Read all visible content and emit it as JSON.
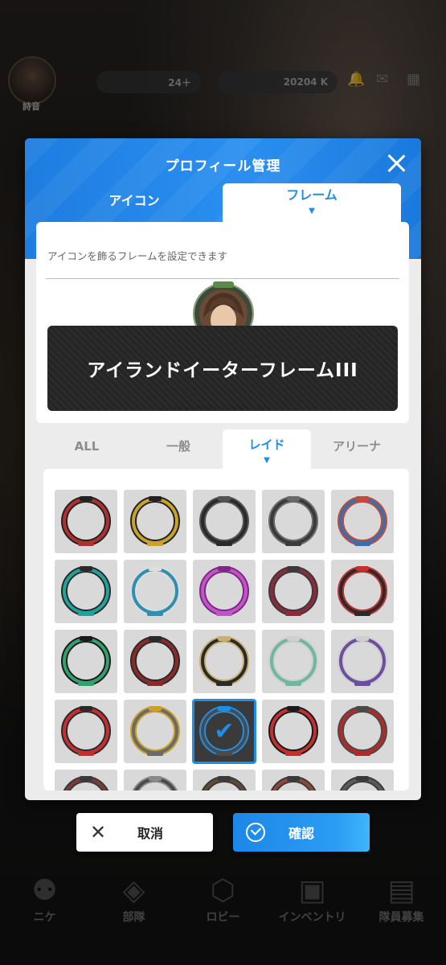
{
  "background": {
    "player_name": "詩音",
    "resource_1": "24＋",
    "resource_2": "20204 K",
    "nav": [
      {
        "label": "ニケ",
        "icon": "people-icon"
      },
      {
        "label": "部隊",
        "icon": "squad-icon"
      },
      {
        "label": "ロビー",
        "icon": "lobby-icon"
      },
      {
        "label": "インベントリ",
        "icon": "inventory-icon"
      },
      {
        "label": "隊員募集",
        "icon": "recruit-icon"
      }
    ]
  },
  "dialog": {
    "title": "プロフィール管理",
    "tabs": [
      {
        "label": "アイコン",
        "active": false
      },
      {
        "label": "フレーム",
        "active": true
      }
    ],
    "description": "アイコンを飾るフレームを設定できます",
    "selected_frame_name": "アイランドイーターフレームIII",
    "categories": [
      {
        "label": "ALL",
        "active": false
      },
      {
        "label": "一般",
        "active": false
      },
      {
        "label": "レイド",
        "active": true
      },
      {
        "label": "アリーナ",
        "active": false
      }
    ],
    "frames": [
      {
        "color": "#b03030",
        "accent": "#222222",
        "selected": false
      },
      {
        "color": "#c9a227",
        "accent": "#222222",
        "selected": false
      },
      {
        "color": "#2a2a2a",
        "accent": "#555555",
        "selected": false
      },
      {
        "color": "#3a3a3a",
        "accent": "#6a6a6a",
        "selected": false
      },
      {
        "color": "#3a6fae",
        "accent": "#c24a3a",
        "selected": false
      },
      {
        "color": "#1fa39a",
        "accent": "#2a2a2a",
        "selected": false
      },
      {
        "color": "#2e8fb0",
        "accent": "#dddddd",
        "selected": false
      },
      {
        "color": "#c552c9",
        "accent": "#7a2a80",
        "selected": false
      },
      {
        "color": "#8a2a3a",
        "accent": "#3a3a3a",
        "selected": false
      },
      {
        "color": "#2a2a2a",
        "accent": "#c23030",
        "selected": false
      },
      {
        "color": "#2fa36b",
        "accent": "#1a1a1a",
        "selected": false
      },
      {
        "color": "#8a2a2a",
        "accent": "#2a2a2a",
        "selected": false
      },
      {
        "color": "#2a2a2a",
        "accent": "#c9b070",
        "selected": false
      },
      {
        "color": "#6fb7a0",
        "accent": "#cfcfcf",
        "selected": false
      },
      {
        "color": "#6a4fa0",
        "accent": "#cfcfcf",
        "selected": false
      },
      {
        "color": "#c23030",
        "accent": "#2a2a2a",
        "selected": false
      },
      {
        "color": "#6a6a6a",
        "accent": "#c9a227",
        "selected": false
      },
      {
        "color": "#4a4a4a",
        "accent": "#1e8fe6",
        "selected": true
      },
      {
        "color": "#c23030",
        "accent": "#1a1a1a",
        "selected": false
      },
      {
        "color": "#b02a2a",
        "accent": "#4a4a4a",
        "selected": false
      },
      {
        "color": "#7a3a3a",
        "accent": "#3a3a3a",
        "selected": false
      },
      {
        "color": "#4a4a4a",
        "accent": "#8a8a8a",
        "selected": false
      },
      {
        "color": "#5a4a3a",
        "accent": "#3a3a3a",
        "selected": false
      },
      {
        "color": "#8a4a3a",
        "accent": "#3a3a3a",
        "selected": false
      },
      {
        "color": "#5a5a5a",
        "accent": "#3a3a3a",
        "selected": false
      }
    ],
    "cancel_label": "取消",
    "confirm_label": "確認"
  },
  "colors": {
    "accent": "#1e8fe6",
    "header": "#2a8ff0",
    "panel": "#ececec"
  }
}
